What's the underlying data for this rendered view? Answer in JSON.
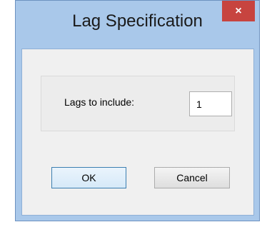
{
  "window": {
    "title": "Lag Specification",
    "close_glyph": "×"
  },
  "lag_group": {
    "label": "Lags to include:",
    "value": "1"
  },
  "buttons": {
    "ok_label": "OK",
    "cancel_label": "Cancel"
  },
  "colors": {
    "frame": "#a9c8ea",
    "close_button": "#c7443f",
    "dialog_body": "#f0f0f0"
  },
  "icons": {
    "close": "close-icon"
  }
}
